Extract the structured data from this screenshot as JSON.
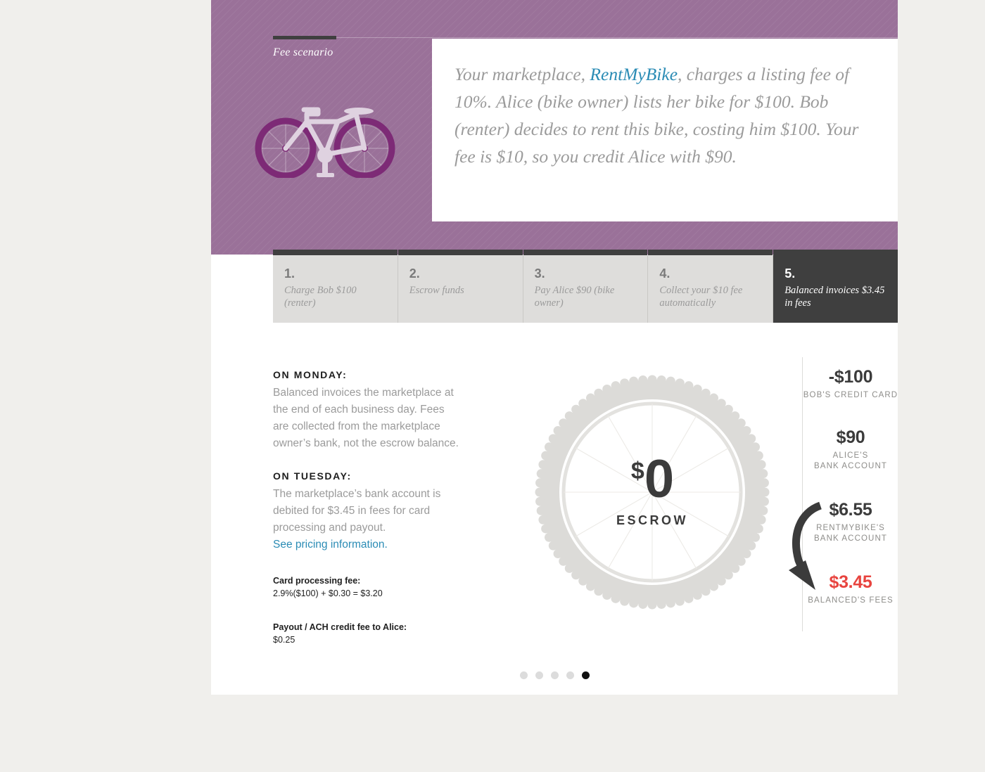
{
  "hero": {
    "label": "Fee scenario",
    "illustration": "bicycle-illustration",
    "quote": {
      "before": "Your marketplace, ",
      "brand": "RentMyBike",
      "after": ", charges a listing fee of 10%. Alice (bike owner) lists her bike for $100. Bob (renter) decides to rent this bike, costing him $100. Your fee is $10, so you credit Alice with $90."
    }
  },
  "steps": [
    {
      "num": "1.",
      "desc": "Charge Bob $100 (renter)",
      "active": false
    },
    {
      "num": "2.",
      "desc": "Escrow funds",
      "active": false
    },
    {
      "num": "3.",
      "desc": "Pay Alice $90 (bike owner)",
      "active": false
    },
    {
      "num": "4.",
      "desc": "Collect your $10 fee automatically",
      "active": false
    },
    {
      "num": "5.",
      "desc": "Balanced invoices $3.45 in fees",
      "active": true
    }
  ],
  "left": {
    "monday_head": "ON MONDAY:",
    "monday_body": "Balanced invoices the marketplace at the end of each business day. Fees are collected from the marketplace owner’s bank, not the escrow balance.",
    "tuesday_head": "ON TUESDAY:",
    "tuesday_body": "The marketplace’s bank account is debited for $3.45 in fees for card processing and payout.",
    "pricing_link": "See pricing information.",
    "card_fee_title": "Card processing fee:",
    "card_fee_value": "2.9%($100) + $0.30 =  $3.20",
    "payout_fee_title": "Payout / ACH credit fee to Alice:",
    "payout_fee_value": "$0.25"
  },
  "wheel": {
    "currency": "$",
    "amount": "0",
    "label": "ESCROW"
  },
  "ledger": [
    {
      "amount": "-$100",
      "caption": "BOB'S CREDIT CARD",
      "color": "#3b3b3b"
    },
    {
      "amount": "$90",
      "caption": "ALICE'S\nBANK ACCOUNT",
      "color": "#3b3b3b"
    },
    {
      "amount": "$6.55",
      "caption": "RENTMYBIKE'S\nBANK ACCOUNT",
      "color": "#3b3b3b"
    },
    {
      "amount": "$3.45",
      "caption": "BALANCED'S FEES",
      "color": "#e8443f"
    }
  ],
  "pagination": {
    "total": 5,
    "active_index": 4
  },
  "colors": {
    "hero_purple": "#9a7199",
    "page_background": "#f0efec",
    "accent_blue": "#2b8cb5",
    "fee_red": "#e8443f",
    "dark": "#3f3f3f",
    "tab_gray": "#dedddb"
  }
}
